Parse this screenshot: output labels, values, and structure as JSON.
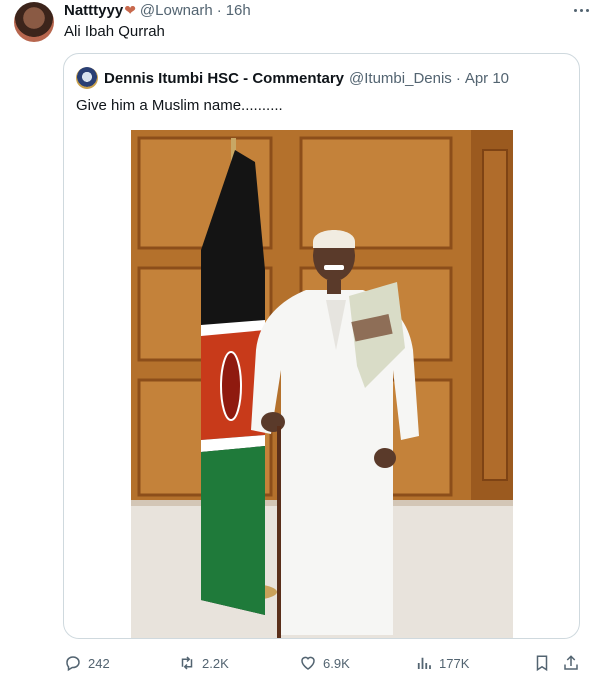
{
  "tweet": {
    "author_name": "Natttyyy",
    "author_emoji": "❤",
    "handle": "@Lownarh",
    "separator": "·",
    "time": "16h",
    "text": "Ali Ibah Qurrah"
  },
  "quote": {
    "author_name": "Dennis Itumbi HSC - Commentary",
    "handle": "@Itumbi_Denis",
    "separator": "·",
    "date": "Apr 10",
    "text": "Give him a Muslim name.........."
  },
  "actions": {
    "replies": "242",
    "retweets": "2.2K",
    "likes": "6.9K",
    "views": "177K"
  },
  "icons": [
    "reply-icon",
    "retweet-icon",
    "like-icon",
    "views-icon",
    "bookmark-icon",
    "share-icon",
    "more-icon"
  ],
  "colors": {
    "text": "#0f1419",
    "secondary": "#536471",
    "border": "#cfd9de",
    "heart": "#c8694d"
  }
}
